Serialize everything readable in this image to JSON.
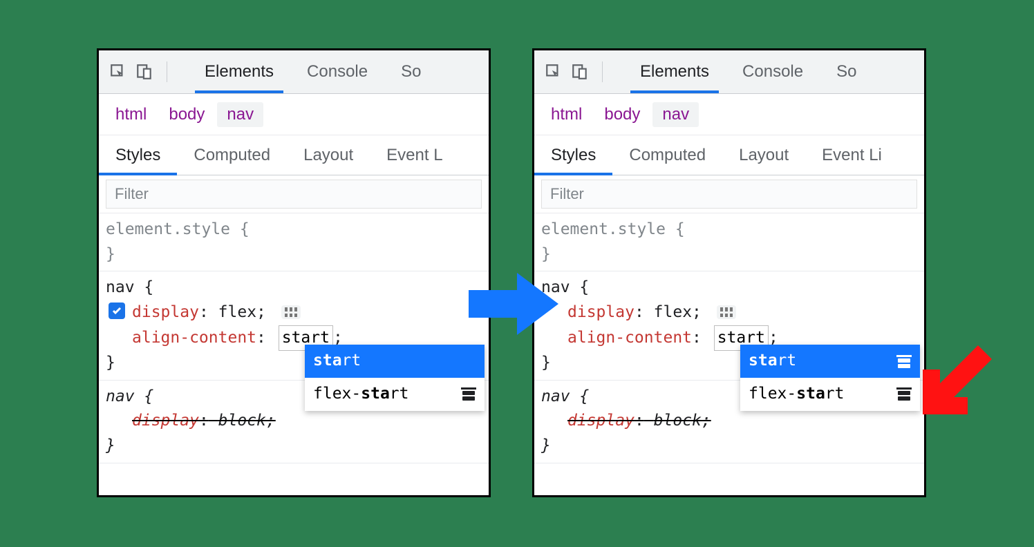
{
  "toolbar": {
    "tabs": {
      "elements": "Elements",
      "console": "Console",
      "sources_partial": "So"
    }
  },
  "breadcrumb": {
    "html": "html",
    "body": "body",
    "nav": "nav"
  },
  "subtabs": {
    "styles": "Styles",
    "computed": "Computed",
    "layout": "Layout",
    "eventlisteners_partial_left": "Event L",
    "eventlisteners_partial_right": "Event Li"
  },
  "filter": {
    "placeholder": "Filter"
  },
  "style_rules": {
    "element_style": "element.style {",
    "close_brace": "}",
    "nav_open": "nav {",
    "display_prop": "display",
    "flex_value": "flex",
    "align_content_prop": "align-content",
    "start_value": "start",
    "semic": ";",
    "nav_italic_open": "nav {",
    "display_italic": "display",
    "block_italic": "block;"
  },
  "autocomplete": {
    "start_bold": "sta",
    "start_rest": "rt",
    "flex_prefix": "flex-",
    "flex_start_bold": "sta",
    "flex_start_rest": "rt"
  },
  "colon": ":"
}
